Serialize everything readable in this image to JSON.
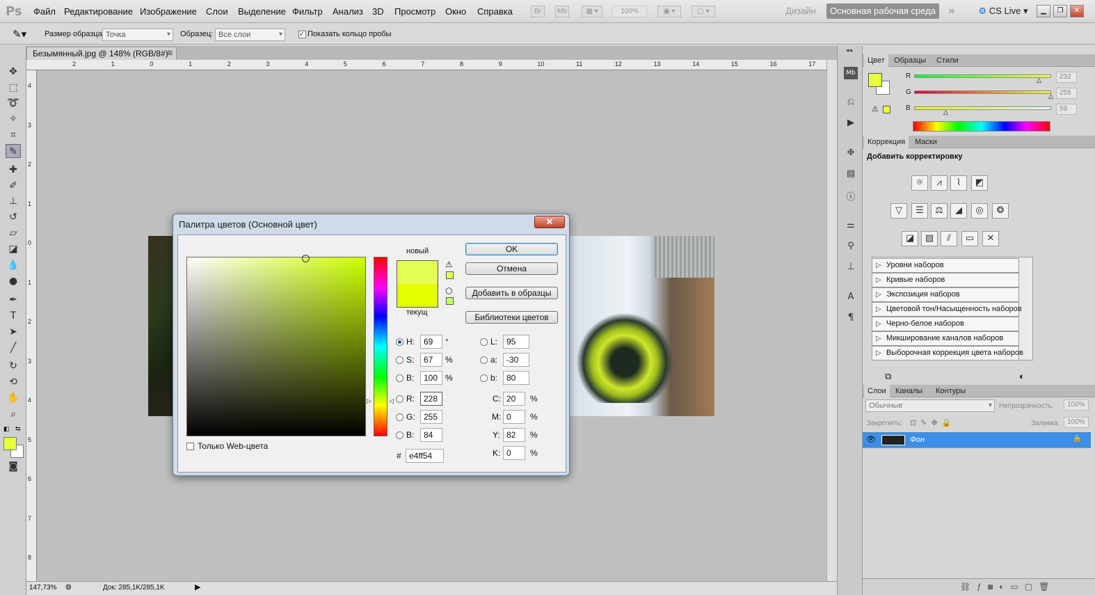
{
  "app": {
    "logo": "Ps",
    "menu": [
      "Файл",
      "Редактирование",
      "Изображение",
      "Слои",
      "Выделение",
      "Фильтр",
      "Анализ",
      "3D",
      "Просмотр",
      "Окно",
      "Справка"
    ],
    "toolbar_icons": [
      "Br",
      "Mb"
    ],
    "zoom_select": "100%",
    "workspace_design": "Дизайн",
    "workspace_main": "Основная рабочая среда",
    "overflow": "»",
    "cs_live": "CS Live"
  },
  "options": {
    "sample_size_label": "Размер образца:",
    "sample_size_value": "Точка",
    "sample_label": "Образец:",
    "sample_value": "Все слои",
    "show_ring_label": "Показать кольцо пробы"
  },
  "document": {
    "tab_title": "Безымянный.jpg @ 148% (RGB/8#)",
    "zoom": "147,73%",
    "doc_info": "Док: 285,1K/285,1K",
    "ruler_top": [
      "2",
      "1",
      "0",
      "1",
      "2",
      "3",
      "4",
      "5",
      "6",
      "7",
      "8",
      "9",
      "10",
      "11",
      "12",
      "13",
      "14",
      "15",
      "16",
      "17"
    ],
    "ruler_left": [
      "4",
      "3",
      "2",
      "1",
      "0",
      "1",
      "2",
      "3",
      "4",
      "5",
      "6",
      "7",
      "8"
    ]
  },
  "dialog": {
    "title": "Палитра цветов (Основной цвет)",
    "close": "✕",
    "label_new": "новый",
    "label_current": "текущ",
    "ok": "OK",
    "cancel": "Отмена",
    "add_swatch": "Добавить в образцы",
    "libraries": "Библиотеки цветов",
    "web_only": "Только Web-цвета",
    "new_color": "#e4ff54",
    "current_color": "#e4ff00",
    "fields": {
      "H": {
        "label": "H:",
        "value": "69",
        "unit": "°"
      },
      "S": {
        "label": "S:",
        "value": "67",
        "unit": "%"
      },
      "B": {
        "label": "B:",
        "value": "100",
        "unit": "%"
      },
      "R": {
        "label": "R:",
        "value": "228"
      },
      "G": {
        "label": "G:",
        "value": "255"
      },
      "Bb": {
        "label": "B:",
        "value": "84"
      },
      "L": {
        "label": "L:",
        "value": "95"
      },
      "a": {
        "label": "a:",
        "value": "-30"
      },
      "b": {
        "label": "b:",
        "value": "80"
      },
      "C": {
        "label": "C:",
        "value": "20",
        "unit": "%"
      },
      "M": {
        "label": "M:",
        "value": "0",
        "unit": "%"
      },
      "Y": {
        "label": "Y:",
        "value": "82",
        "unit": "%"
      },
      "K": {
        "label": "K:",
        "value": "0",
        "unit": "%"
      }
    },
    "hex_label": "#",
    "hex_value": "e4ff54"
  },
  "color_panel": {
    "tabs": [
      "Цвет",
      "Образцы",
      "Стили"
    ],
    "foreground": "#e8ff3b",
    "R": {
      "label": "R",
      "value": "232"
    },
    "G": {
      "label": "G",
      "value": "255"
    },
    "B": {
      "label": "B",
      "value": "59"
    }
  },
  "adjust_panel": {
    "tabs": [
      "Коррекция",
      "Маски"
    ],
    "heading": "Добавить корректировку",
    "presets": [
      "Уровни наборов",
      "Кривые наборов",
      "Экспозиция наборов",
      "Цветовой тон/Насыщенность наборов",
      "Черно-белое наборов",
      "Микширование каналов наборов",
      "Выборочная коррекция цвета наборов"
    ]
  },
  "layers_panel": {
    "tabs": [
      "Слои",
      "Каналы",
      "Контуры"
    ],
    "blend_mode": "Обычные",
    "opacity_label": "Непрозрачность:",
    "opacity_value": "100%",
    "lock_label": "Закрепить:",
    "fill_label": "Заливка:",
    "fill_value": "100%",
    "layer_name": "Фон",
    "selected_color": "#3d8fe6"
  }
}
